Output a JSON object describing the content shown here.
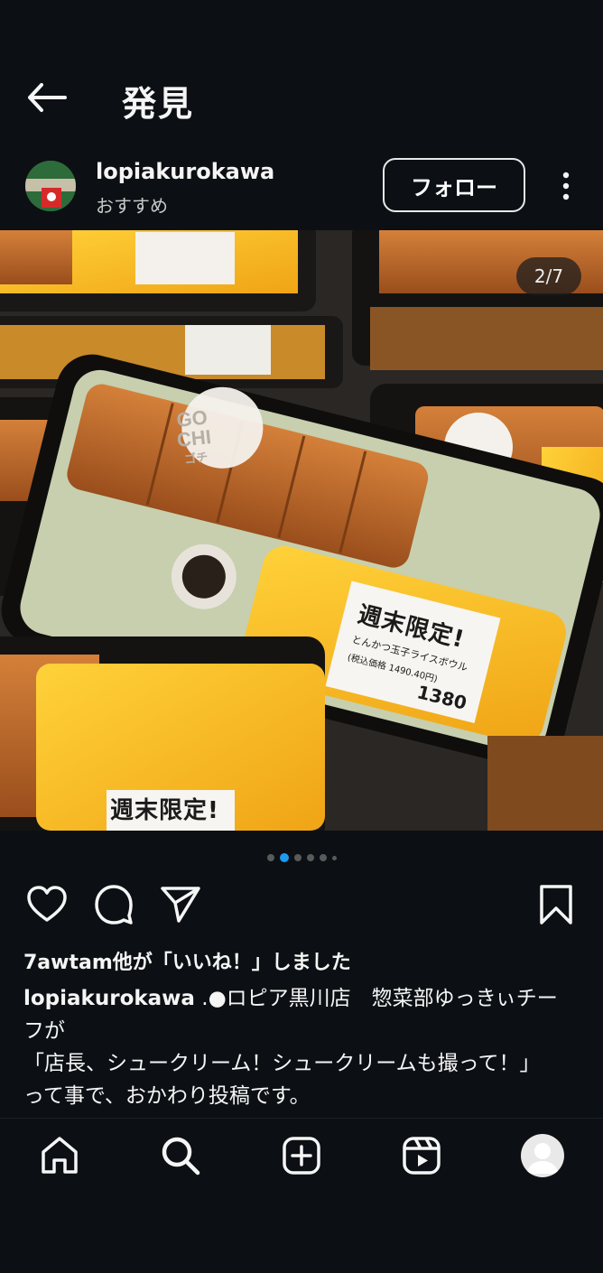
{
  "header": {
    "title": "発見"
  },
  "post": {
    "username": "lopiakurokawa",
    "subtitle": "おすすめ",
    "follow_label": "フォロー",
    "image_counter": "2/7",
    "image_texts": {
      "badge_top": "GO CHI",
      "badge_bottom": "ゴチ",
      "label_main": "週末限定!",
      "label_product": "とんかつ玉子ライスボウル",
      "label_price": "1380",
      "label_price_incl": "(税込価格 1490.40円)",
      "label_bottom": "週末限定!"
    },
    "carousel": {
      "count": 6,
      "active_index": 1
    },
    "likes_text": "7awtam他が「いいね！」しました",
    "caption_user": "lopiakurokawa",
    "caption_text": " .●ロピア黒川店　惣菜部ゆっきぃチーフが",
    "caption_line2": "「店長、シュークリーム！シュークリームも撮って！」",
    "caption_line3": "って事で、おかわり投稿です。"
  },
  "icons": {
    "back": "back-arrow-icon",
    "more": "more-vertical-icon",
    "like": "heart-icon",
    "comment": "comment-icon",
    "share": "send-icon",
    "save": "bookmark-icon",
    "home": "home-icon",
    "search": "search-icon",
    "create": "create-icon",
    "reels": "reels-icon",
    "profile": "profile-avatar"
  },
  "colors": {
    "background": "#0c1014",
    "active_dot": "#1d9bf0",
    "text": "#f5f5f5"
  }
}
